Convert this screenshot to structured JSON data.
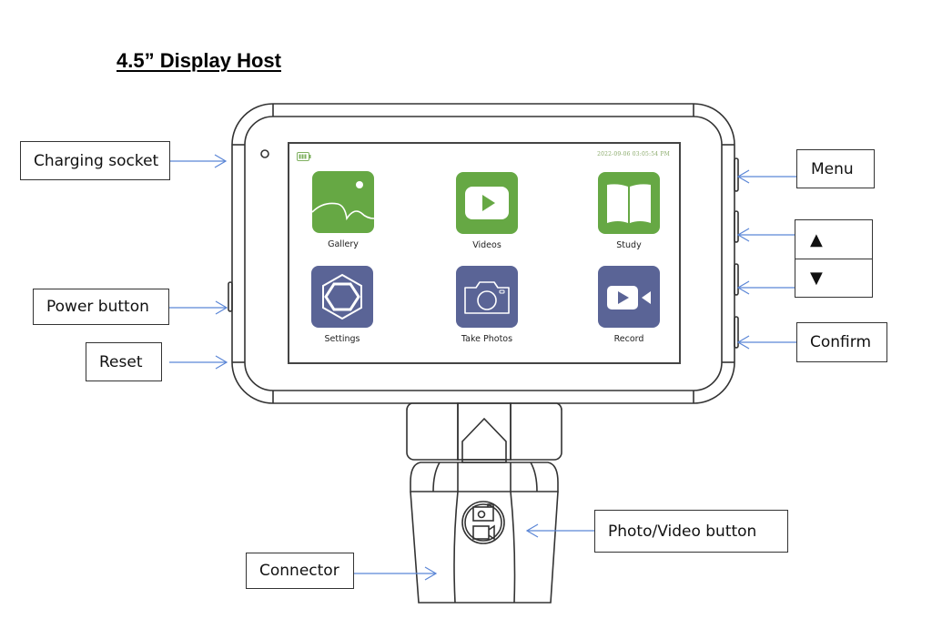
{
  "title": "4.5” Display Host",
  "colors": {
    "arrow": "#5b86d6",
    "app_green": "#66a844",
    "app_purple": "#5a6496",
    "outline": "#333333"
  },
  "screen": {
    "battery_icon": "battery-icon",
    "datetime": "2022-09-06 03:05:54 PM",
    "apps": [
      {
        "label": "Gallery",
        "icon": "image-icon",
        "color": "green"
      },
      {
        "label": "Videos",
        "icon": "play-icon",
        "color": "green"
      },
      {
        "label": "Study",
        "icon": "book-icon",
        "color": "green"
      },
      {
        "label": "Settings",
        "icon": "hexagon-settings-icon",
        "color": "purple"
      },
      {
        "label": "Take Photos",
        "icon": "camera-icon",
        "color": "purple"
      },
      {
        "label": "Record",
        "icon": "video-camera-icon",
        "color": "purple"
      }
    ]
  },
  "callouts": {
    "charging_socket": "Charging socket",
    "power_button": "Power button",
    "reset": "Reset",
    "menu": "Menu",
    "up": "▲",
    "down": "▼",
    "confirm": "Confirm",
    "photo_video_button": "Photo/Video button",
    "connector": "Connector"
  }
}
